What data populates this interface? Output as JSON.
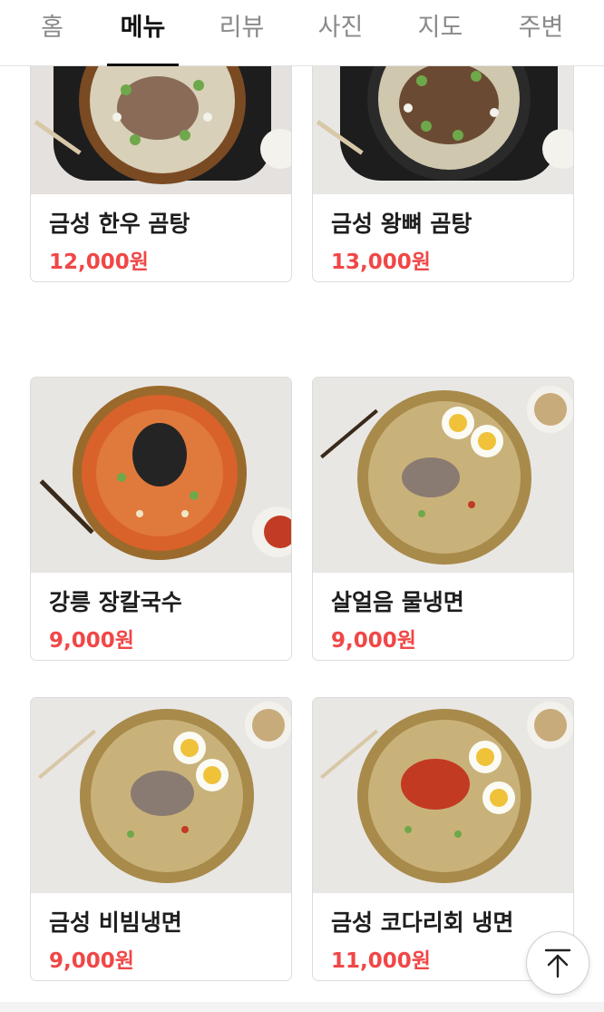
{
  "tabs": [
    {
      "label": "홈",
      "active": false
    },
    {
      "label": "메뉴",
      "active": true
    },
    {
      "label": "리뷰",
      "active": false
    },
    {
      "label": "사진",
      "active": false
    },
    {
      "label": "지도",
      "active": false
    },
    {
      "label": "주변",
      "active": false
    }
  ],
  "menu": [
    {
      "name": "금성 한우 곰탕",
      "price": "12,000원"
    },
    {
      "name": "금성 왕뼈 곰탕",
      "price": "13,000원"
    },
    {
      "name": "강릉 장칼국수",
      "price": "9,000원"
    },
    {
      "name": "살얼음 물냉면",
      "price": "9,000원"
    },
    {
      "name": "금성 비빔냉면",
      "price": "9,000원"
    },
    {
      "name": "금성 코다리회 냉면",
      "price": "11,000원"
    }
  ],
  "colors": {
    "price": "#f04747",
    "active_tab": "#111111",
    "inactive_tab": "#8a8a8a"
  },
  "icons": {
    "scroll_top": "arrow-up-to-top-icon"
  }
}
